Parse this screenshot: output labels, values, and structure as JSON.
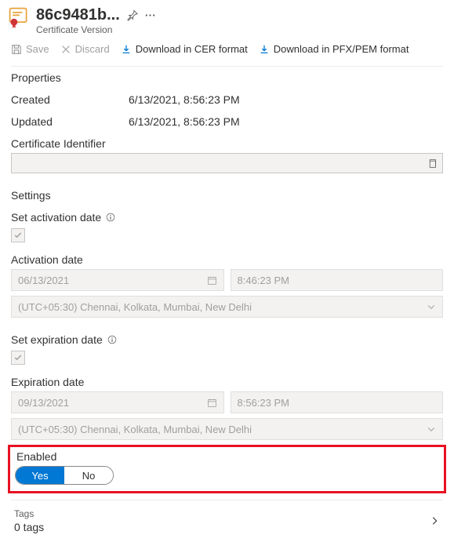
{
  "header": {
    "title": "86c9481b...",
    "subtitle": "Certificate Version"
  },
  "toolbar": {
    "save": "Save",
    "discard": "Discard",
    "download_cer": "Download in CER format",
    "download_pfx": "Download in PFX/PEM format"
  },
  "properties": {
    "heading": "Properties",
    "created_label": "Created",
    "created_value": "6/13/2021, 8:56:23 PM",
    "updated_label": "Updated",
    "updated_value": "6/13/2021, 8:56:23 PM",
    "cert_id_label": "Certificate Identifier"
  },
  "settings": {
    "heading": "Settings",
    "activation_toggle_label": "Set activation date",
    "activation_date_label": "Activation date",
    "activation_date": "06/13/2021",
    "activation_time": "8:46:23 PM",
    "activation_tz": "(UTC+05:30) Chennai, Kolkata, Mumbai, New Delhi",
    "expiration_toggle_label": "Set expiration date",
    "expiration_date_label": "Expiration date",
    "expiration_date": "09/13/2021",
    "expiration_time": "8:56:23 PM",
    "expiration_tz": "(UTC+05:30) Chennai, Kolkata, Mumbai, New Delhi"
  },
  "enabled": {
    "label": "Enabled",
    "yes": "Yes",
    "no": "No"
  },
  "tags": {
    "label": "Tags",
    "count": "0 tags"
  }
}
